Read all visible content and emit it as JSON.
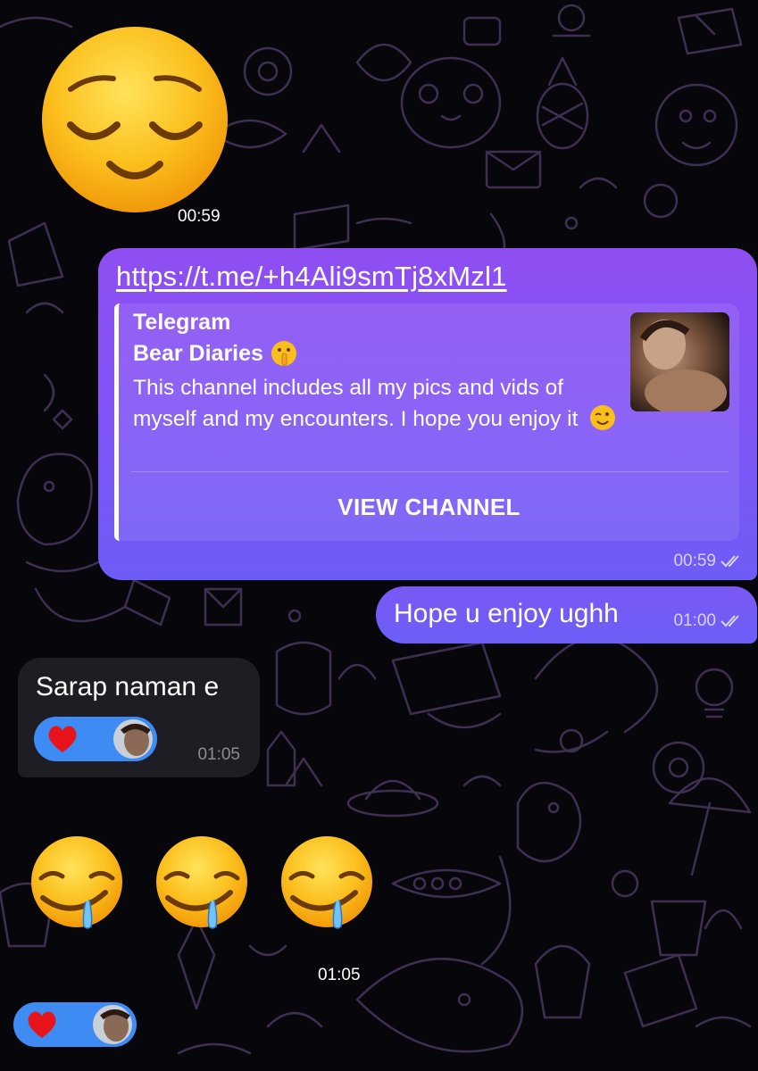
{
  "colors": {
    "background": "#07060a",
    "doodle_stroke": "#4c3a66",
    "outgoing_bubble_top": "#8f4ef2",
    "outgoing_bubble_bottom": "#6e5cf7",
    "incoming_bubble": "#1e1d24",
    "reaction_pill": "#3e8cf3"
  },
  "messages": {
    "emoji_sticker": {
      "emoji": "relieved-face",
      "time": "00:59"
    },
    "link_message": {
      "url": "https://t.me/+h4Ali9smTj8xMzl1",
      "preview": {
        "site_name": "Telegram",
        "title": "Bear Diaries",
        "title_emoji": "shushing-face",
        "description": "This channel includes all my pics and vids of myself and my encounters. I hope you enjoy it",
        "description_emoji": "winking-face",
        "thumbnail": "channel-photo",
        "button_label": "VIEW CHANNEL"
      },
      "time": "00:59",
      "status": "read"
    },
    "outgoing_text": {
      "text": "Hope u enjoy ughh",
      "time": "01:00",
      "status": "read"
    },
    "incoming_text": {
      "text": "Sarap naman e",
      "time": "01:05",
      "reaction": {
        "emoji": "red-heart",
        "reactor": "user-avatar"
      }
    },
    "drooling_emojis": {
      "emojis": [
        "drooling-face",
        "drooling-face",
        "drooling-face"
      ],
      "time": "01:05",
      "reaction": {
        "emoji": "red-heart",
        "reactor": "user-avatar"
      }
    }
  }
}
